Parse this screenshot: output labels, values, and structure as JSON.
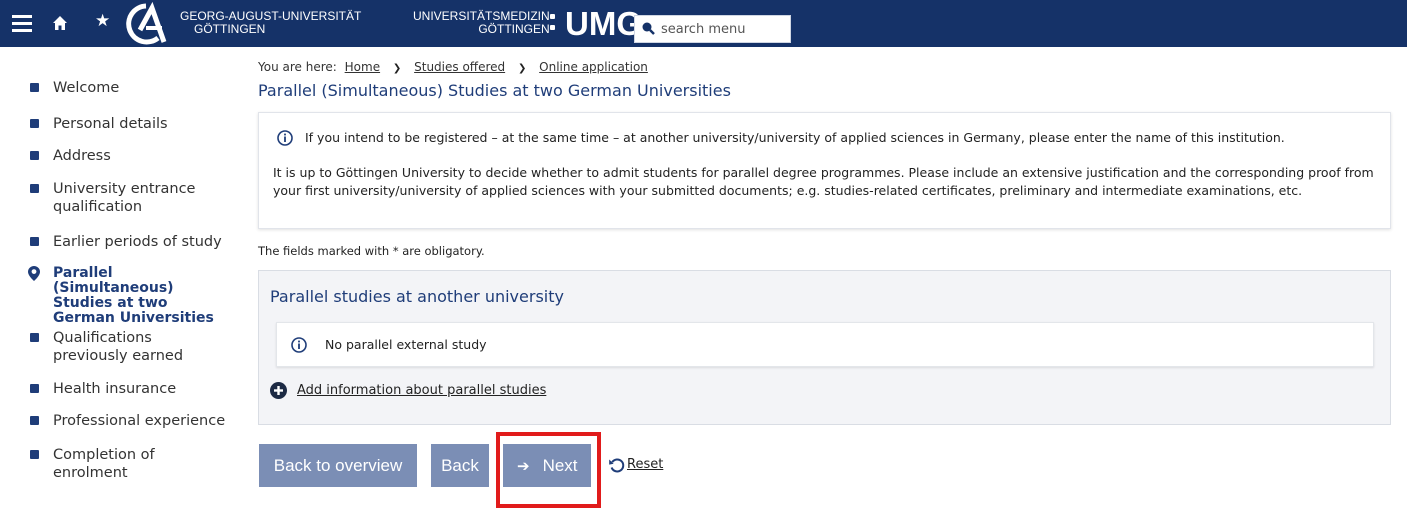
{
  "header": {
    "university_line1": "GEORG-AUGUST-UNIVERSITÄT",
    "university_line2": "GÖTTINGEN",
    "medicine_line1": "UNIVERSITÄTSMEDIZIN",
    "medicine_line2": "GÖTTINGEN",
    "umg_logo": "UMG",
    "search_placeholder": "search menu",
    "colors": {
      "bar": "#153268",
      "accent": "#1f3d79"
    }
  },
  "breadcrumb": {
    "prefix": "You are here:",
    "items": [
      "Home",
      "Studies offered",
      "Online application"
    ]
  },
  "page_title": "Parallel (Simultaneous) Studies at two German Universities",
  "sidebar": {
    "items": [
      {
        "label": "Welcome"
      },
      {
        "label": "Personal details"
      },
      {
        "label": "Address"
      },
      {
        "label": "University entrance qualification"
      },
      {
        "label": "Earlier periods of study"
      },
      {
        "label": "Parallel (Simultaneous) Studies at two German Universities",
        "active": true
      },
      {
        "label": "Qualifications previously earned"
      },
      {
        "label": "Health insurance"
      },
      {
        "label": "Professional experience"
      },
      {
        "label": "Completion of enrolment"
      }
    ]
  },
  "info": {
    "line1": "If you intend to be registered – at the same time – at another university/university of applied sciences in Germany, please enter the name of this institution.",
    "line2": "It is up to Göttingen University to decide whether to admit students for parallel degree programmes. Please include an extensive justification and the corresponding proof from your first university/university of applied sciences with your submitted documents; e.g. studies-related certificates, preliminary and intermediate examinations, etc."
  },
  "obligatory_note": "The fields marked with * are obligatory.",
  "parallel_studies": {
    "title": "Parallel studies at another university",
    "note": "No parallel external study",
    "add_link": "Add information about parallel studies"
  },
  "buttons": {
    "overview": "Back to overview",
    "back": "Back",
    "next": "Next",
    "reset": "Reset",
    "color": "#7b8eb5",
    "highlight_color": "#e11b1b"
  }
}
